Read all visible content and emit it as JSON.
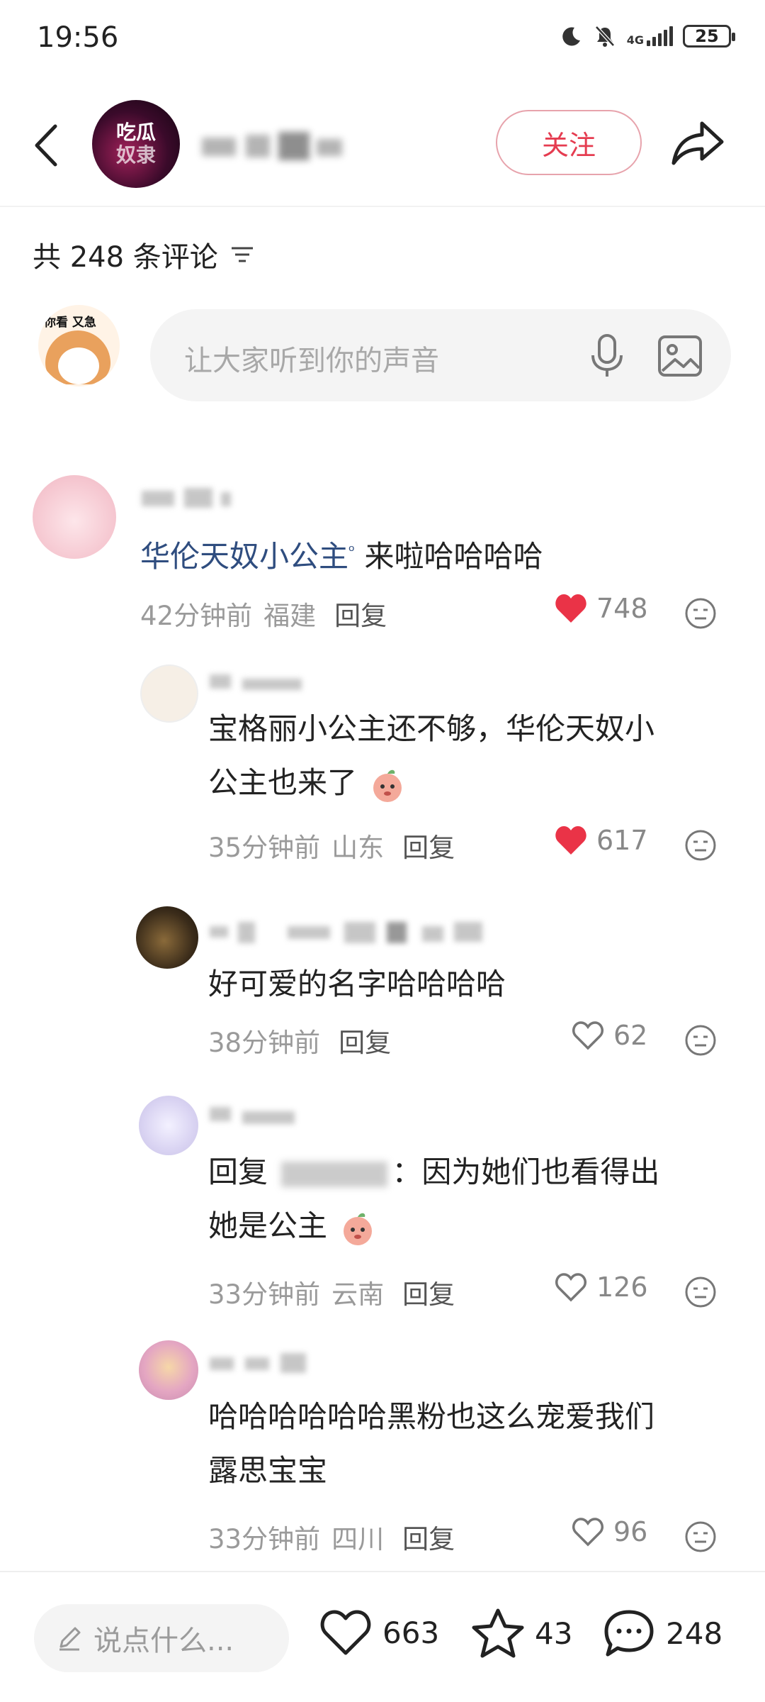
{
  "status_bar": {
    "time": "19:56",
    "network": "4G",
    "battery": "25"
  },
  "header": {
    "account_avatar_text": [
      "吃瓜",
      "奴隶"
    ],
    "follow_label": "关注"
  },
  "comments_header": {
    "count_text": "共 248 条评论"
  },
  "input": {
    "avatar_tag": "你看 又急",
    "placeholder": "让大家听到你的声音"
  },
  "comments": [
    {
      "link_text": "华伦天奴小公主",
      "text": "来啦哈哈哈哈",
      "time": "42分钟前",
      "location": "福建",
      "reply_label": "回复",
      "likes": "748",
      "liked": true
    },
    {
      "text_line1": "宝格丽小公主还不够，华伦天奴小",
      "text_line2": "公主也来了",
      "time": "35分钟前",
      "location": "山东",
      "reply_label": "回复",
      "likes": "617",
      "liked": true
    },
    {
      "text": "好可爱的名字哈哈哈哈",
      "time": "38分钟前",
      "location": "",
      "reply_label": "回复",
      "likes": "62",
      "liked": false
    },
    {
      "reply_prefix": "回复",
      "text_line1": "：因为她们也看得出",
      "text_line2": "她是公主",
      "time": "33分钟前",
      "location": "云南",
      "reply_label": "回复",
      "likes": "126",
      "liked": false
    },
    {
      "text_line1": "哈哈哈哈哈哈黑粉也这么宠爱我们",
      "text_line2": "露思宝宝",
      "time": "33分钟前",
      "location": "四川",
      "reply_label": "回复",
      "likes": "96",
      "liked": false
    }
  ],
  "bottom_bar": {
    "say_placeholder": "说点什么...",
    "likes": "663",
    "favorites": "43",
    "comments": "248"
  },
  "colors": {
    "accent_red": "#e53c50",
    "link_blue": "#2f4d7f",
    "meta_gray": "#9a9a9a"
  },
  "icons": [
    "back-arrow-icon",
    "share-icon",
    "filter-icon",
    "mic-icon",
    "image-icon",
    "heart-icon",
    "dislike-icon",
    "pen-icon",
    "star-icon",
    "comment-bubble-icon"
  ]
}
